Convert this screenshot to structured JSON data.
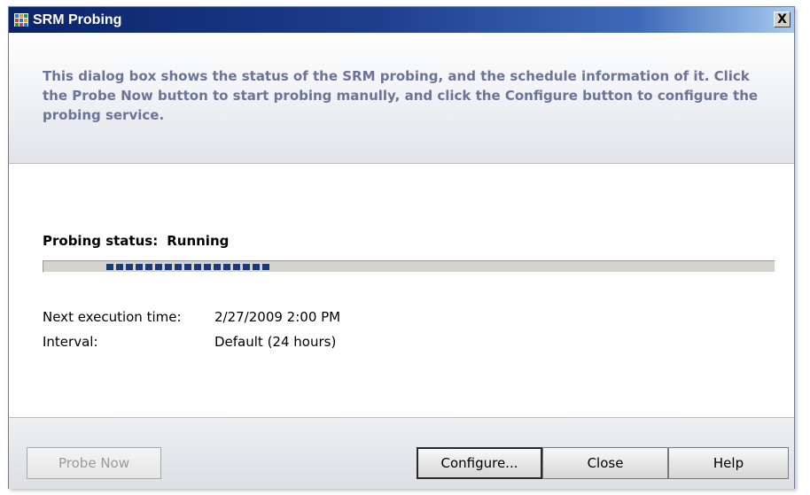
{
  "window": {
    "title": "SRM Probing",
    "close_glyph": "X"
  },
  "header": {
    "description": "This dialog box shows the status of the SRM probing, and the schedule information of it. Click the Probe Now button to start probing manully, and click the Configure button to configure the probing service."
  },
  "status": {
    "label": "Probing status:",
    "value": "Running"
  },
  "progress": {
    "mode": "marquee",
    "block_count": 17,
    "color": "#1a3a78"
  },
  "schedule": {
    "next_execution_label": "Next execution time:",
    "next_execution_value": "2/27/2009 2:00 PM",
    "interval_label": "Interval:",
    "interval_value": "Default (24 hours)"
  },
  "buttons": {
    "probe_now": "Probe Now",
    "configure": "Configure...",
    "close": "Close",
    "help": "Help"
  },
  "colors": {
    "title_bar": "#0a246a",
    "header_text": "#6b7499",
    "icon_cells": [
      "#2a7ad4",
      "#e0a020",
      "#2aa02a",
      "#d04040",
      "#2a7ad4",
      "#e0a020",
      "#2aa02a",
      "#d04040",
      "#2a7ad4"
    ]
  }
}
